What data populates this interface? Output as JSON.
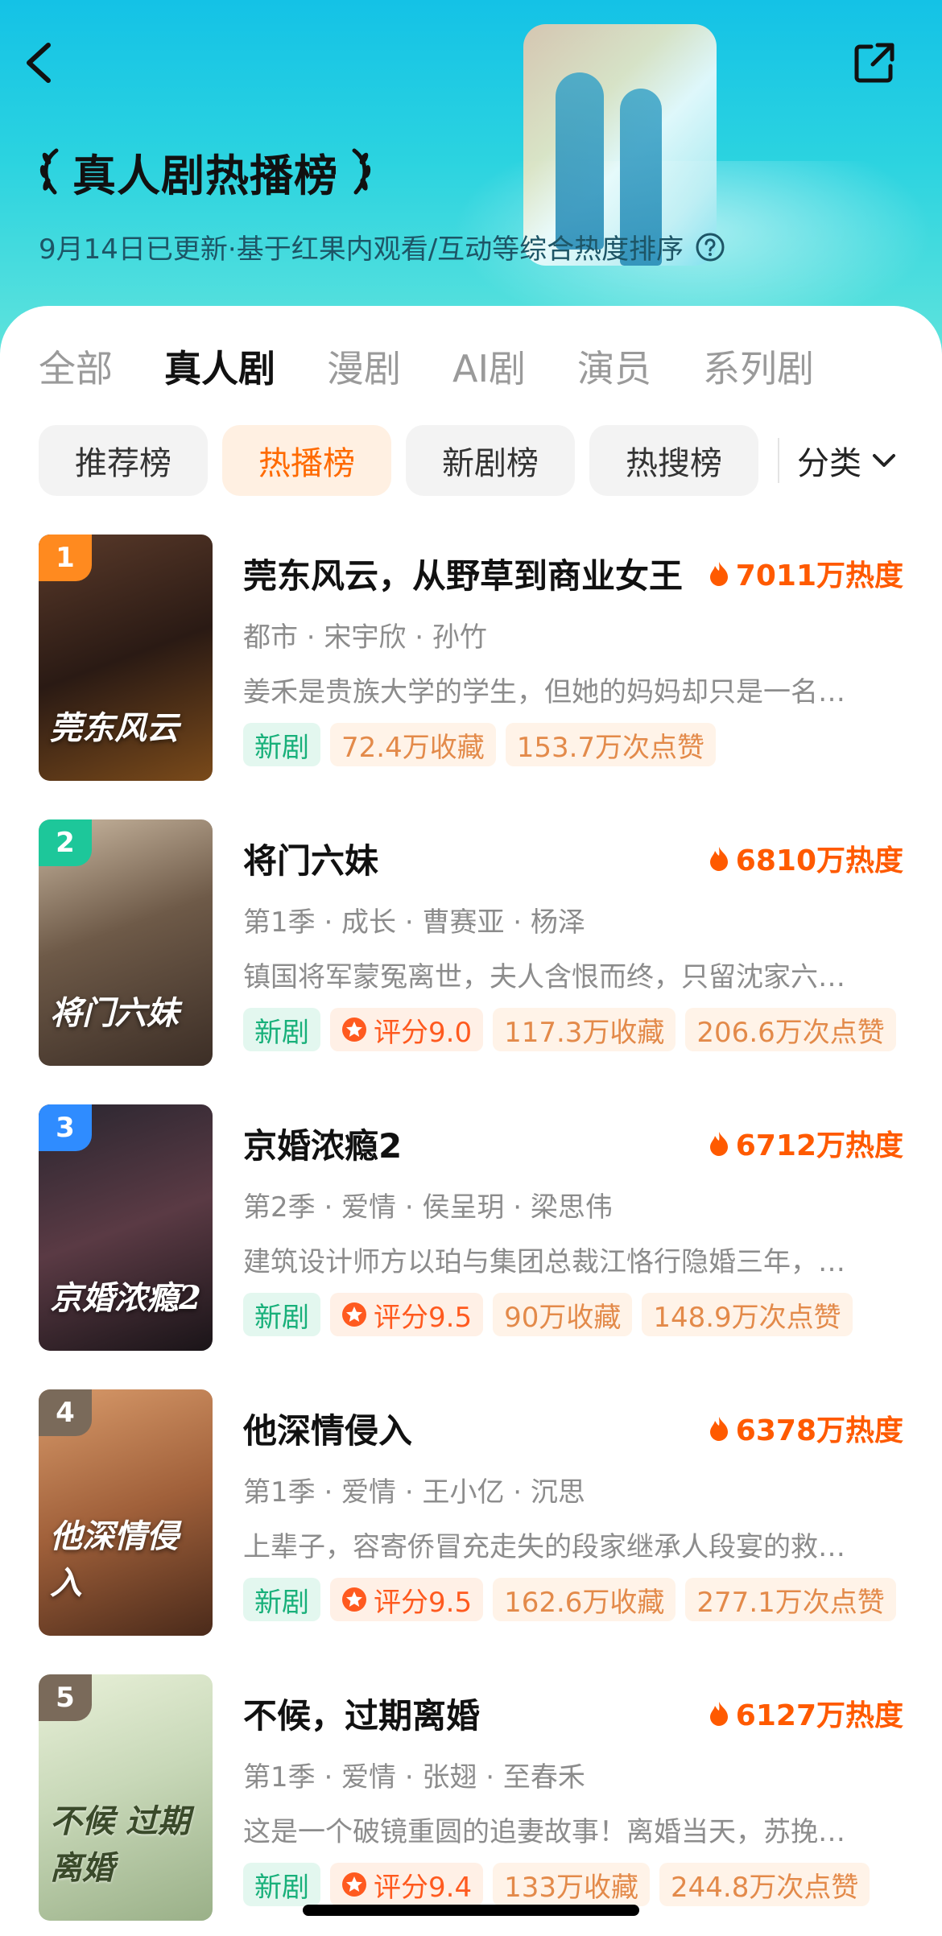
{
  "header": {
    "title": "真人剧热播榜",
    "subtitle": "9月14日已更新·基于红果内观看/互动等综合热度排序"
  },
  "tabs": [
    {
      "label": "全部",
      "active": false
    },
    {
      "label": "真人剧",
      "active": true
    },
    {
      "label": "漫剧",
      "active": false
    },
    {
      "label": "AI剧",
      "active": false
    },
    {
      "label": "演员",
      "active": false
    },
    {
      "label": "系列剧",
      "active": false
    }
  ],
  "chips": [
    {
      "label": "推荐榜",
      "active": false
    },
    {
      "label": "热播榜",
      "active": true
    },
    {
      "label": "新剧榜",
      "active": false
    },
    {
      "label": "热搜榜",
      "active": false
    }
  ],
  "category_label": "分类",
  "colors": {
    "accent": "#ff5a00",
    "rank1": "#ff8a1f",
    "rank2": "#1dc79a",
    "rank3": "#2f8cff",
    "rank_other": "#7a6a5a"
  },
  "items": [
    {
      "rank": "1",
      "title": "莞东风云，从野草到商业女王",
      "heat": "7011万热度",
      "meta": "都市 · 宋宇欣 · 孙竹",
      "desc": "姜禾是贵族大学的学生，但她的妈妈却只是一名…",
      "tag_new": "新剧",
      "score": "",
      "collect": "72.4万收藏",
      "likes": "153.7万次点赞",
      "poster_text": "莞东风云"
    },
    {
      "rank": "2",
      "title": "将门六妹",
      "heat": "6810万热度",
      "meta": "第1季 · 成长 · 曹赛亚 · 杨泽",
      "desc": "镇国将军蒙冤离世，夫人含恨而终，只留沈家六…",
      "tag_new": "新剧",
      "score": "评分9.0",
      "collect": "117.3万收藏",
      "likes": "206.6万次点赞",
      "poster_text": "将门六妹"
    },
    {
      "rank": "3",
      "title": "京婚浓瘾2",
      "heat": "6712万热度",
      "meta": "第2季 · 爱情 · 侯呈玥 · 梁思伟",
      "desc": "建筑设计师方以珀与集团总裁江恪行隐婚三年，…",
      "tag_new": "新剧",
      "score": "评分9.5",
      "collect": "90万收藏",
      "likes": "148.9万次点赞",
      "poster_text": "京婚浓瘾2"
    },
    {
      "rank": "4",
      "title": "他深情侵入",
      "heat": "6378万热度",
      "meta": "第1季 · 爱情 · 王小亿 · 沉思",
      "desc": "上辈子，容寄侨冒充走失的段家继承人段宴的救…",
      "tag_new": "新剧",
      "score": "评分9.5",
      "collect": "162.6万收藏",
      "likes": "277.1万次点赞",
      "poster_text": "他深情侵入"
    },
    {
      "rank": "5",
      "title": "不候，过期离婚",
      "heat": "6127万热度",
      "meta": "第1季 · 爱情 · 张翅 · 至春禾",
      "desc": "这是一个破镜重圆的追妻故事！离婚当天，苏挽…",
      "tag_new": "新剧",
      "score": "评分9.4",
      "collect": "133万收藏",
      "likes": "244.8万次点赞",
      "poster_text": "不候 过期离婚"
    }
  ]
}
